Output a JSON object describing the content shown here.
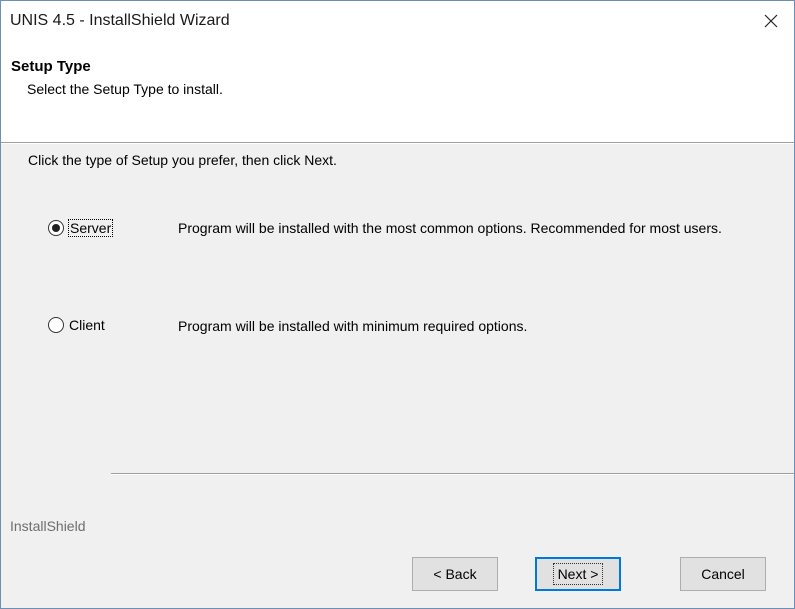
{
  "window": {
    "title": "UNIS 4.5 - InstallShield Wizard",
    "close_icon": "close-icon"
  },
  "header": {
    "title": "Setup Type",
    "subtitle": "Select the Setup Type to install."
  },
  "body": {
    "instruction": "Click the type of Setup you prefer, then click Next.",
    "options": [
      {
        "label": "Server",
        "selected": true,
        "description": "Program will be installed with the most common options.  Recommended for most users."
      },
      {
        "label": "Client",
        "selected": false,
        "description": "Program will be installed with minimum required options."
      }
    ]
  },
  "footer": {
    "brand": "InstallShield",
    "back_label": "< Back",
    "next_label": "Next >",
    "cancel_label": "Cancel"
  },
  "colors": {
    "accent": "#0078d7",
    "header_bg": "#ffffff",
    "body_bg": "#f0f0f0"
  }
}
